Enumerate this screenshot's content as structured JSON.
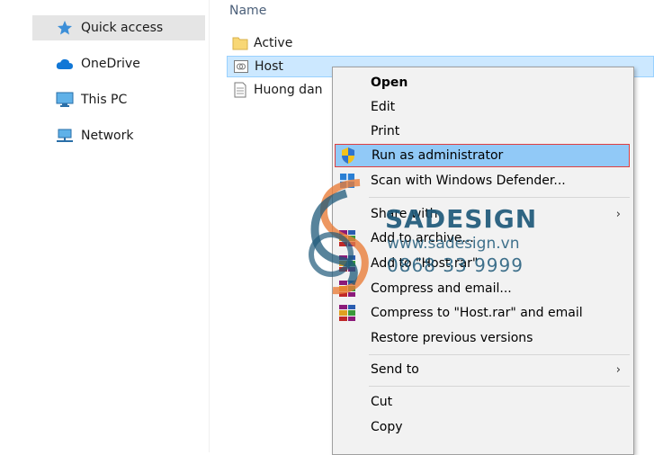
{
  "nav": {
    "items": [
      {
        "label": "Quick access",
        "icon": "star-icon",
        "selected": true
      },
      {
        "label": "OneDrive",
        "icon": "cloud-icon"
      },
      {
        "label": "This PC",
        "icon": "monitor-icon"
      },
      {
        "label": "Network",
        "icon": "network-icon"
      }
    ]
  },
  "files": {
    "column_header": "Name",
    "rows": [
      {
        "name": "Active",
        "icon": "folder-icon"
      },
      {
        "name": "Host",
        "icon": "file-system-icon",
        "selected": true
      },
      {
        "name": "Huong dan",
        "icon": "text-file-icon"
      }
    ]
  },
  "context_menu": {
    "items": {
      "open": "Open",
      "edit": "Edit",
      "print": "Print",
      "run_as_admin": "Run as administrator",
      "scan_defender": "Scan with Windows Defender...",
      "share_with": "Share with",
      "add_to_archive": "Add to archive...",
      "add_to_host_rar": "Add to \"Host.rar\"",
      "compress_email": "Compress and email...",
      "compress_host_rar_email": "Compress to \"Host.rar\" and email",
      "restore_previous": "Restore previous versions",
      "send_to": "Send to",
      "cut": "Cut",
      "copy": "Copy"
    },
    "submenu_arrow": "›"
  },
  "watermark": {
    "brand": "SADESIGN",
    "website": "www.sadesign.vn",
    "phone": "0868 33 9999"
  },
  "colors": {
    "selection": "#cce8ff",
    "menu_highlight": "#91c9f7",
    "highlight_border": "#e04040",
    "watermark": "#1f5a7a"
  }
}
